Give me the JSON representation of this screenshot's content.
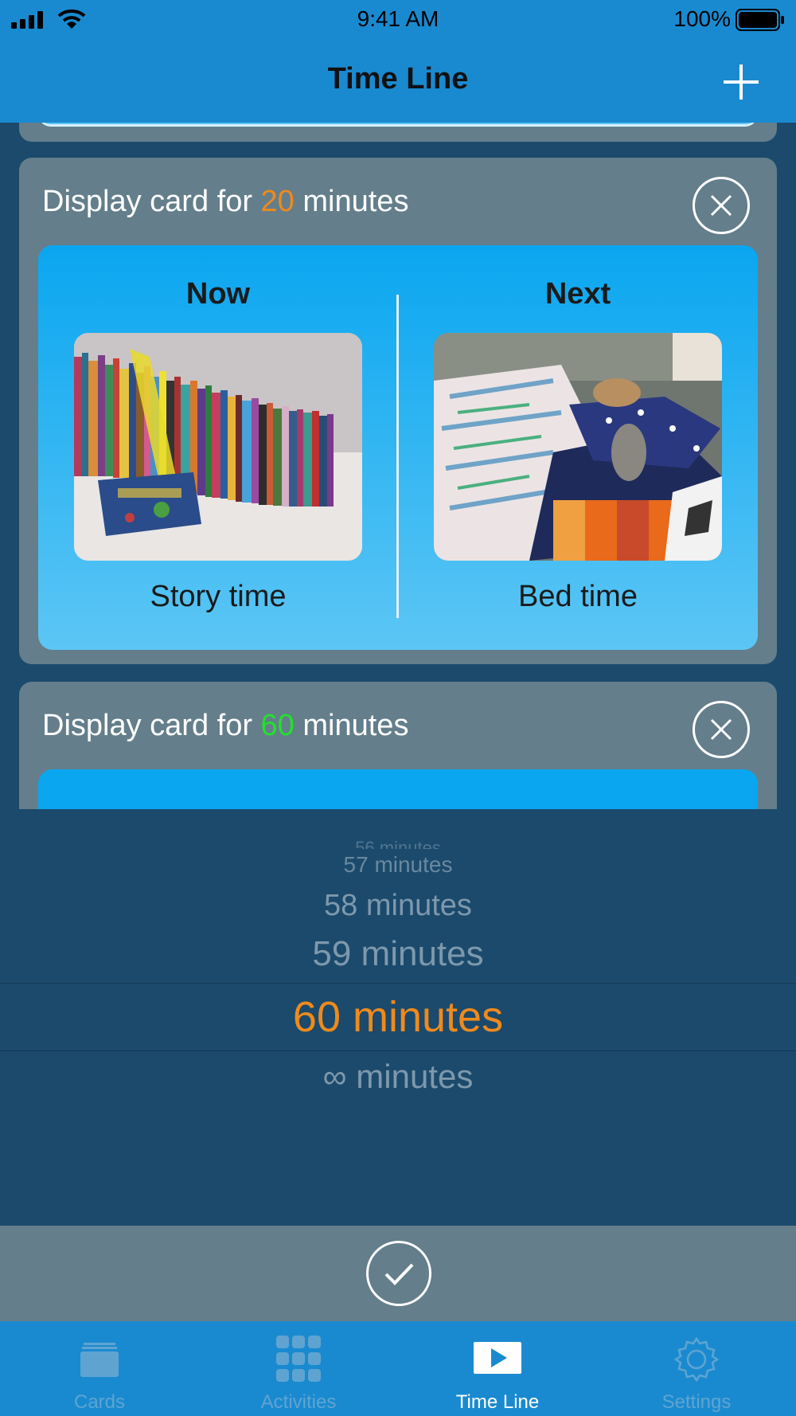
{
  "status_bar": {
    "time": "9:41 AM",
    "battery": "100%"
  },
  "nav": {
    "title": "Time Line",
    "add_icon": "plus-icon"
  },
  "cards": [
    {
      "prefix": "Display card for ",
      "minutes": "20",
      "minutes_color": "#f08a1c",
      "suffix": " minutes",
      "now_title": "Now",
      "next_title": "Next",
      "now_label": "Story time",
      "next_label": "Bed time"
    },
    {
      "prefix": "Display card for ",
      "minutes": "60",
      "minutes_color": "#22e12b",
      "suffix": " minutes"
    }
  ],
  "picker": {
    "options": [
      "56 minutes",
      "57 minutes",
      "58 minutes",
      "59 minutes",
      "60 minutes",
      "∞ minutes"
    ],
    "selected": "60 minutes",
    "selected_color": "#f08a1c"
  },
  "tabs": [
    {
      "label": "Cards",
      "icon": "cards-icon",
      "active": false
    },
    {
      "label": "Activities",
      "icon": "grid-icon",
      "active": false
    },
    {
      "label": "Time Line",
      "icon": "play-icon",
      "active": true
    },
    {
      "label": "Settings",
      "icon": "gear-icon",
      "active": false
    }
  ]
}
